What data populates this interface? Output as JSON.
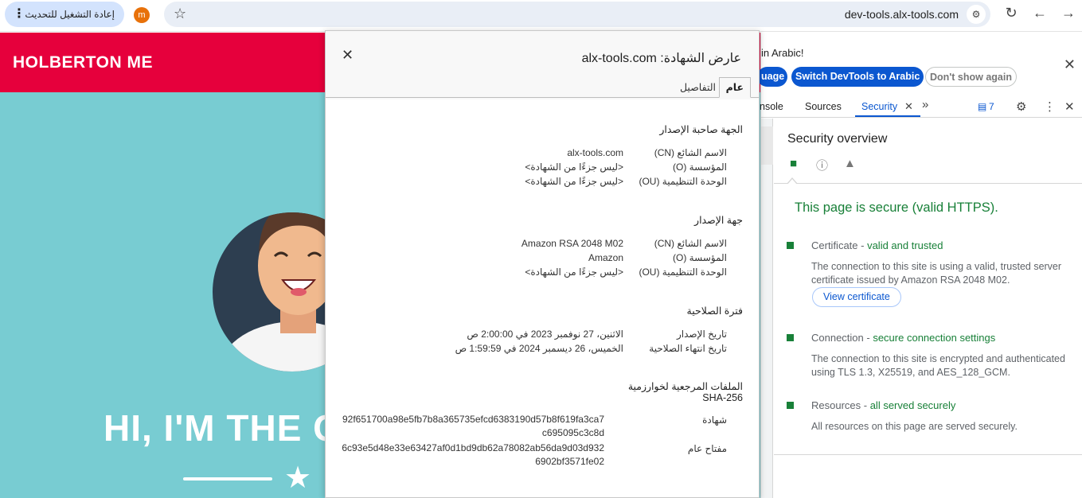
{
  "browser": {
    "relaunch_label": "إعادة التشغيل للتحديث",
    "avatar_letter": "m",
    "url": "dev-tools.alx-tools.com"
  },
  "site": {
    "logo": "HOLBERTON ME",
    "hero_title": "HI, I'M THE C"
  },
  "devtools": {
    "banner_text": "in Arabic!",
    "btn_language": "uage",
    "btn_switch": "Switch DevTools to Arabic",
    "btn_dont_show": "Don't show again",
    "tabs": {
      "console": "nsole",
      "sources": "Sources",
      "security": "Security"
    },
    "message_count": "7",
    "security": {
      "title": "Security overview",
      "headline": "This page is secure (valid HTTPS).",
      "certificate": {
        "label": "Certificate - ",
        "status": "valid and trusted",
        "desc": "The connection to this site is using a valid, trusted server certificate issued by Amazon RSA 2048 M02.",
        "button": "View certificate"
      },
      "connection": {
        "label": "Connection - ",
        "status": "secure connection settings",
        "desc": "The connection to this site is encrypted and authenticated using TLS 1.3, X25519, and AES_128_GCM."
      },
      "resources": {
        "label": "Resources - ",
        "status": "all served securely",
        "desc": "All resources on this page are served securely."
      }
    }
  },
  "cert_dialog": {
    "title": "عارض الشهادة: alx-tools.com",
    "tab_general": "عام",
    "tab_details": "التفاصيل",
    "issued_to": {
      "heading": "الجهة صاحبة الإصدار",
      "rows": [
        {
          "label": "الاسم الشائع (CN)",
          "value": "alx-tools.com"
        },
        {
          "label": "المؤسسة (O)",
          "value": "<ليس جزءًا من الشهادة>"
        },
        {
          "label": "الوحدة التنظيمية (OU)",
          "value": "<ليس جزءًا من الشهادة>"
        }
      ]
    },
    "issued_by": {
      "heading": "جهة الإصدار",
      "rows": [
        {
          "label": "الاسم الشائع (CN)",
          "value": "Amazon RSA 2048 M02"
        },
        {
          "label": "المؤسسة (O)",
          "value": "Amazon"
        },
        {
          "label": "الوحدة التنظيمية (OU)",
          "value": "<ليس جزءًا من الشهادة>"
        }
      ]
    },
    "validity": {
      "heading": "فترة الصلاحية",
      "rows": [
        {
          "label": "تاريخ الإصدار",
          "value": "الاثنين، 27 نوفمبر 2023 في 2:00:00 ص"
        },
        {
          "label": "تاريخ انتهاء الصلاحية",
          "value": "الخميس، 26 ديسمبر 2024 في 1:59:59 ص"
        }
      ]
    },
    "fingerprints": {
      "heading": "الملفات المرجعية لخوارزمية SHA-256",
      "rows": [
        {
          "label": "شهادة",
          "value": "92f651700a98e5fb7b8a365735efcd6383190d57b8f619fa3ca7c695095c3c8d"
        },
        {
          "label": "مفتاح عام",
          "value": "6c93e5d48e33e63427af0d1bd9db62a78082ab56da9d03d9326902bf3571fe02"
        }
      ]
    }
  }
}
